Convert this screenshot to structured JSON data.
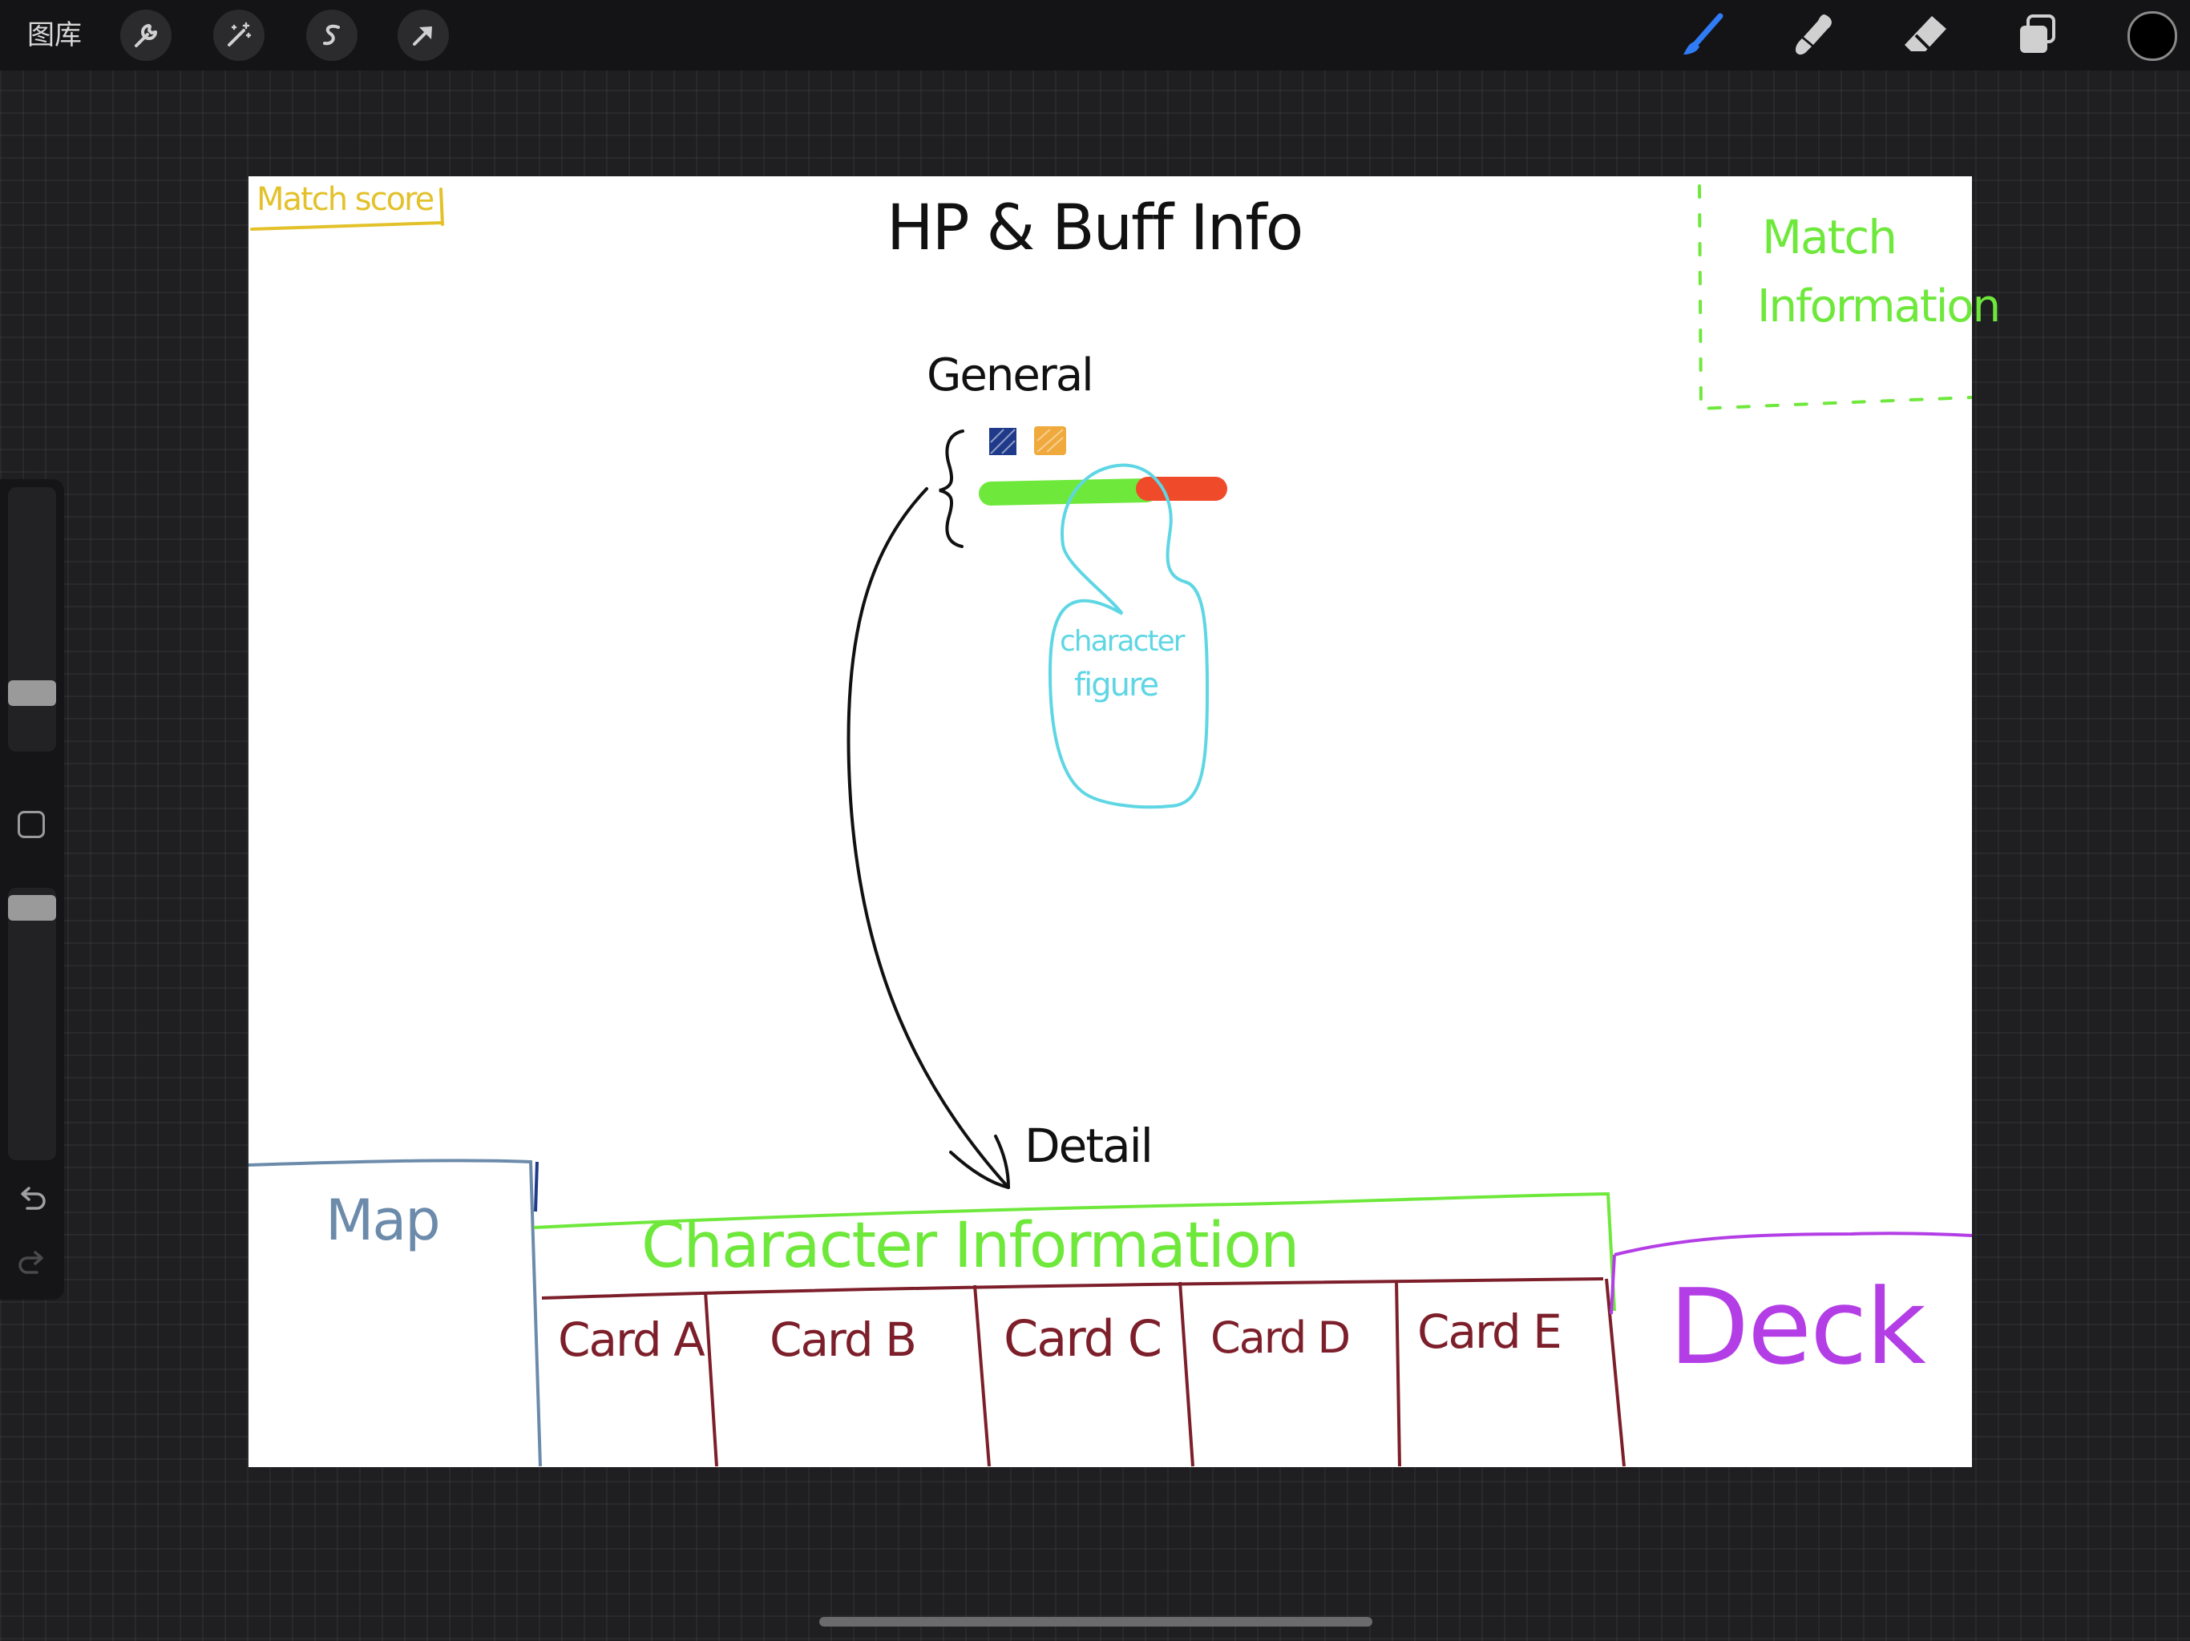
{
  "app": {
    "gallery_label": "图库",
    "tools_left": [
      "wrench-icon",
      "magic-wand-icon",
      "selection-s-icon",
      "transform-arrow-icon"
    ],
    "tools_right": [
      "brush-icon",
      "smudge-icon",
      "eraser-icon",
      "layers-icon"
    ],
    "current_color": "#000000",
    "brush_color": "#2f7cf6"
  },
  "sidebar": {
    "brush_size": 0.19,
    "opacity": 0.97
  },
  "sketch": {
    "match_score": "Match score",
    "title": "HP & Buff Info",
    "match_information_1": "Match",
    "match_information_2": "Information",
    "general": "General",
    "character_figure_1": "character",
    "character_figure_2": "figure",
    "detail": "Detail",
    "map": "Map",
    "character_information": "Character Information",
    "cards": [
      "Card A",
      "Card B",
      "Card C",
      "Card D",
      "Card E"
    ],
    "deck": "Deck",
    "colors": {
      "yellow": "#e3c12a",
      "green": "#6fe83c",
      "cyan": "#5ed6e4",
      "navy": "#1f3a8a",
      "orange": "#f0a93c",
      "red": "#ef4b2b",
      "steel": "#6c8bab",
      "maroon": "#7d1f2a",
      "purple": "#b43ee6"
    }
  }
}
